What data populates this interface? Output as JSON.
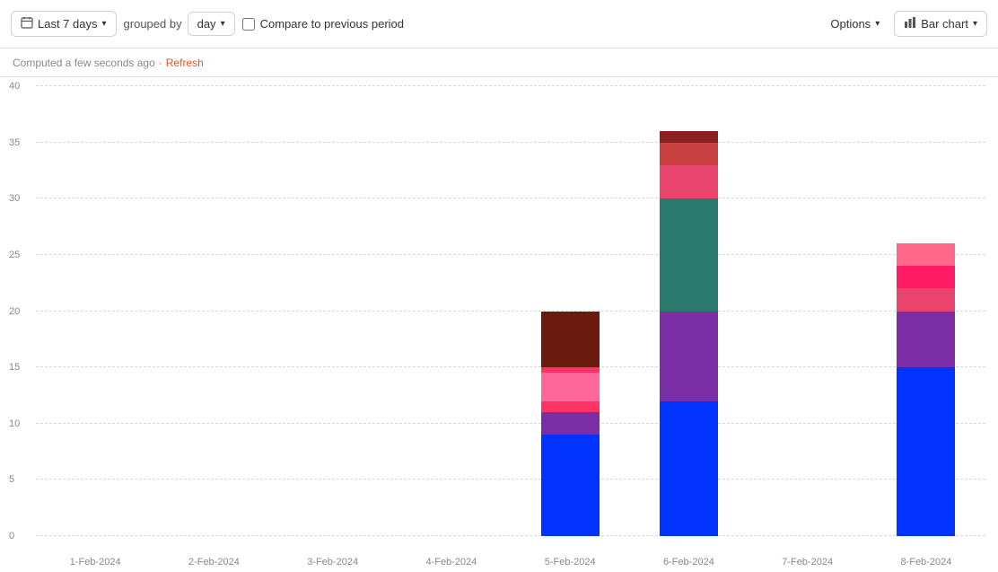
{
  "toolbar": {
    "date_range_label": "Last 7 days",
    "grouped_by_label": "grouped by",
    "day_label": "day",
    "compare_label": "Compare to previous period",
    "options_label": "Options",
    "bar_chart_label": "Bar chart"
  },
  "status_bar": {
    "computed_text": "Computed a few seconds ago",
    "separator": "·",
    "refresh_label": "Refresh"
  },
  "chart": {
    "y_max": 40,
    "y_ticks": [
      0,
      5,
      10,
      15,
      20,
      25,
      30,
      35,
      40
    ],
    "x_labels": [
      "1-Feb-2024",
      "2-Feb-2024",
      "3-Feb-2024",
      "4-Feb-2024",
      "5-Feb-2024",
      "6-Feb-2024",
      "7-Feb-2024",
      "8-Feb-2024"
    ],
    "bars": [
      {
        "date": "1-Feb-2024",
        "segments": []
      },
      {
        "date": "2-Feb-2024",
        "segments": []
      },
      {
        "date": "3-Feb-2024",
        "segments": []
      },
      {
        "date": "4-Feb-2024",
        "segments": []
      },
      {
        "date": "5-Feb-2024",
        "segments": [
          {
            "value": 9,
            "color": "#0033ff"
          },
          {
            "value": 2,
            "color": "#7b2da6"
          },
          {
            "value": 1,
            "color": "#ff3366"
          },
          {
            "value": 2.5,
            "color": "#ff6699"
          },
          {
            "value": 0.5,
            "color": "#ff3366"
          },
          {
            "value": 5,
            "color": "#6b1a0f"
          }
        ]
      },
      {
        "date": "6-Feb-2024",
        "segments": [
          {
            "value": 12,
            "color": "#0033ff"
          },
          {
            "value": 7,
            "color": "#7b2da6"
          },
          {
            "value": 1,
            "color": "#7b2da6"
          },
          {
            "value": 10,
            "color": "#2a7a6e"
          },
          {
            "value": 3,
            "color": "#e8446e"
          },
          {
            "value": 2,
            "color": "#c84040"
          },
          {
            "value": 1,
            "color": "#8b2020"
          }
        ]
      },
      {
        "date": "7-Feb-2024",
        "segments": []
      },
      {
        "date": "8-Feb-2024",
        "segments": [
          {
            "value": 15,
            "color": "#0033ff"
          },
          {
            "value": 3,
            "color": "#7b2da6"
          },
          {
            "value": 2,
            "color": "#7b2da6"
          },
          {
            "value": 2,
            "color": "#e8446e"
          },
          {
            "value": 2,
            "color": "#ff1a66"
          },
          {
            "value": 2,
            "color": "#ff6688"
          }
        ]
      }
    ]
  },
  "icons": {
    "calendar": "📅",
    "bar_chart": "▐",
    "chevron_down": "▾"
  }
}
